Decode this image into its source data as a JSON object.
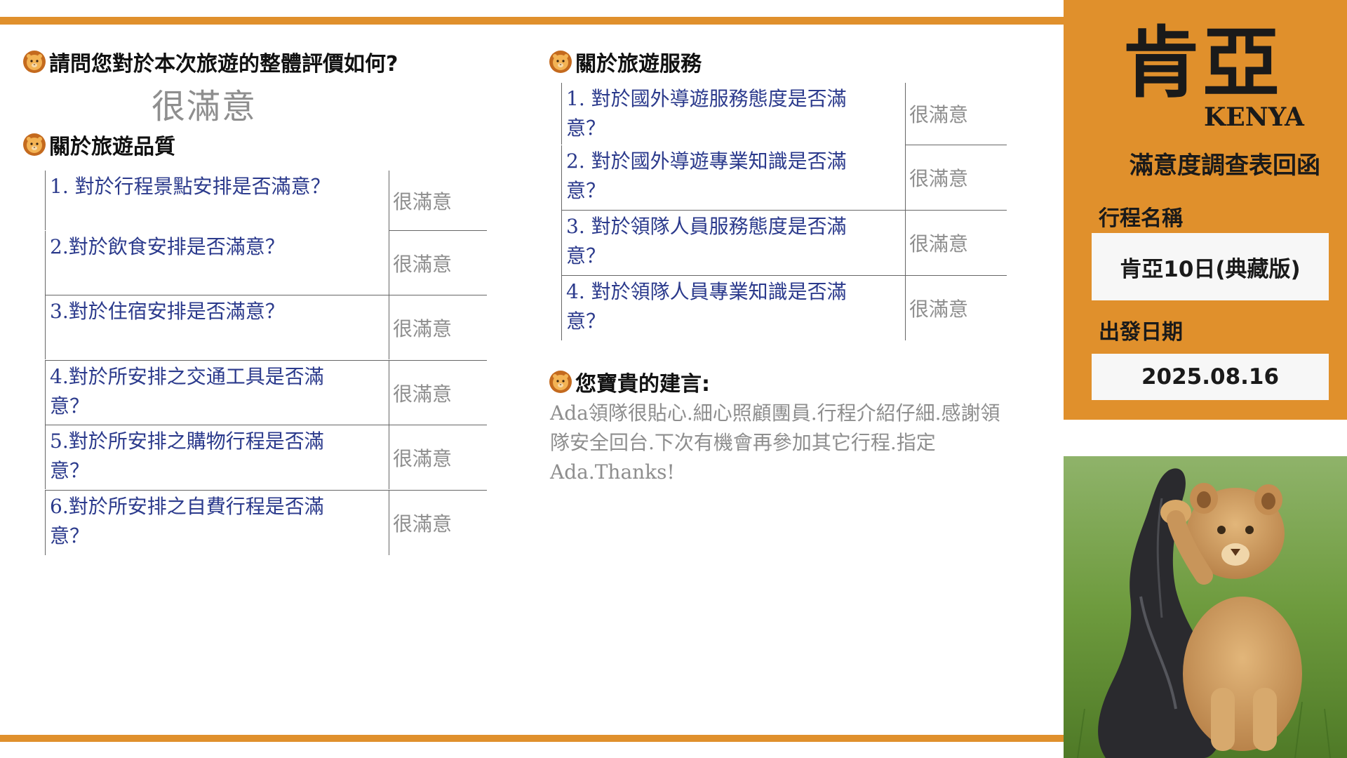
{
  "overall": {
    "heading": "請問您對於本次旅遊的整體評價如何?",
    "value": "很滿意"
  },
  "quality": {
    "heading": "關於旅遊品質",
    "rows": [
      {
        "q1": "1. 對於行程景點安排是否滿意？",
        "q2": "",
        "a": "很滿意"
      },
      {
        "q1": "2.對於飲食安排是否滿意？",
        "q2": "",
        "a": "很滿意"
      },
      {
        "q1": "3.對於住宿安排是否滿意？",
        "q2": "",
        "a": "很滿意"
      },
      {
        "q1": "4.對於所安排之交通工具是否滿",
        "q2": "意？",
        "a": "很滿意"
      },
      {
        "q1": "5.對於所安排之購物行程是否滿",
        "q2": "意？",
        "a": "很滿意"
      },
      {
        "q1": "6.對於所安排之自費行程是否滿",
        "q2": "意？",
        "a": "很滿意"
      }
    ]
  },
  "service": {
    "heading": "關於旅遊服務",
    "rows": [
      {
        "q1": "1. 對於國外導遊服務態度是否滿",
        "q2": "意？",
        "a": "很滿意"
      },
      {
        "q1": "2. 對於國外導遊專業知識是否滿",
        "q2": "意？",
        "a": "很滿意"
      },
      {
        "q1": "3. 對於領隊人員服務態度是否滿",
        "q2": "意？",
        "a": "很滿意"
      },
      {
        "q1": "4. 對於領隊人員專業知識是否滿",
        "q2": "意？",
        "a": "很滿意"
      }
    ]
  },
  "advice": {
    "heading": "您寶貴的建言:",
    "lines": [
      "Ada領隊很貼心.細心照顧團員.行程介紹仔細.感謝領",
      "隊安全回台.下次有機會再參加其它行程.指定",
      "Ada.Thanks!"
    ]
  },
  "panel": {
    "title": "肯亞",
    "title_en": "KENYA",
    "subtitle": "滿意度調查表回函",
    "trip_label": "行程名稱",
    "trip_value": "肯亞10日(典藏版)",
    "date_label": "出發日期",
    "date_value": "2025.08.16"
  },
  "colors": {
    "accent": "#e0902c",
    "question_text": "#2b3a8c",
    "answer_text": "#8e8e8e"
  },
  "icons": [
    "lion-icon"
  ],
  "photo_subject": "lion cub climbing a charred tree stump on grass"
}
